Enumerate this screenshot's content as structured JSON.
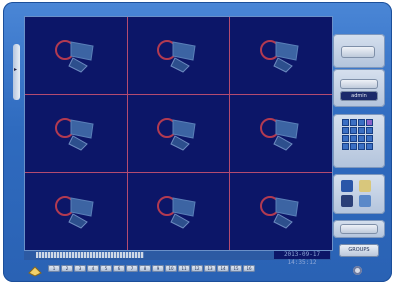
{
  "window": {
    "frame_color": "#2f6bbf"
  },
  "left_tab": {
    "label": ""
  },
  "grid": {
    "tiles": [
      {
        "label": ""
      },
      {
        "label": ""
      },
      {
        "label": ""
      },
      {
        "label": ""
      },
      {
        "label": ""
      },
      {
        "label": ""
      },
      {
        "label": ""
      },
      {
        "label": ""
      },
      {
        "label": ""
      }
    ]
  },
  "panel": {
    "top_button_label": "",
    "login_user": "admin",
    "bottom_button_label": "GROUPS",
    "search_icon": "search-icon",
    "config_icon": "gear-icon"
  },
  "status": {
    "time_text": "2013-09-17 14:35:12"
  },
  "channels": [
    "1",
    "2",
    "3",
    "4",
    "5",
    "6",
    "7",
    "8",
    "9",
    "10",
    "11",
    "12",
    "13",
    "14",
    "15",
    "16"
  ],
  "colors": {
    "grid_bg": "#0c1668",
    "grid_line": "#b34b70",
    "accent": "#4a86d6"
  }
}
